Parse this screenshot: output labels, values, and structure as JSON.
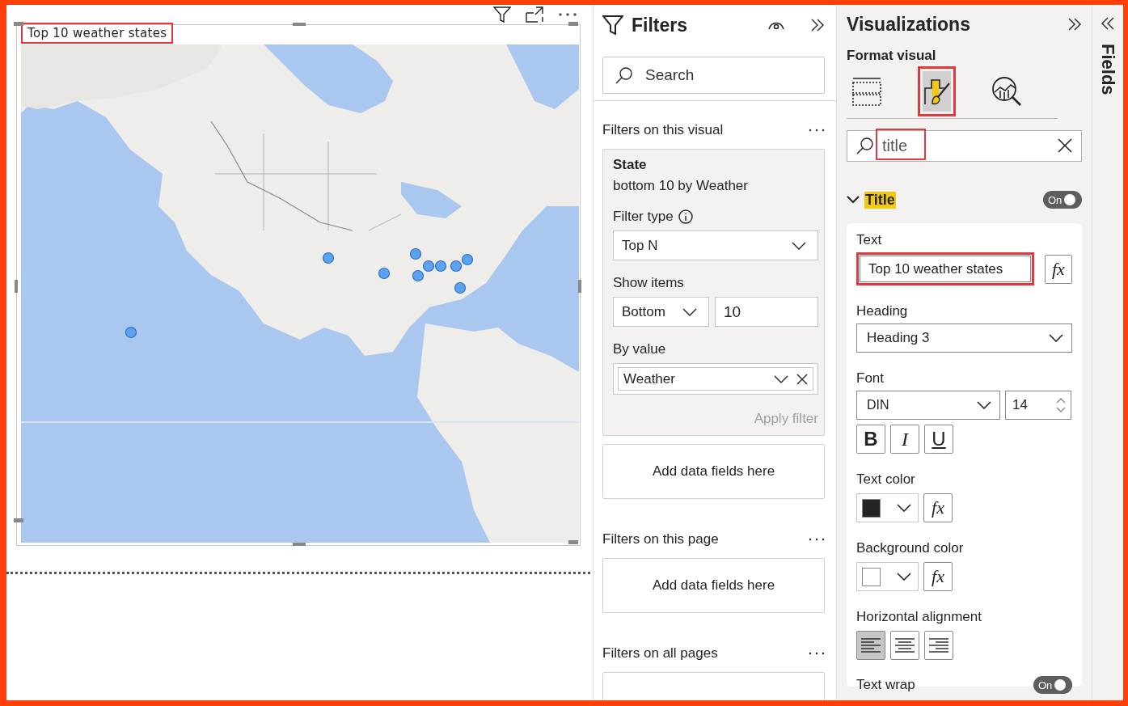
{
  "visual": {
    "title": "Top 10 weather states",
    "title_highlighted": true
  },
  "filters": {
    "title": "Filters",
    "search": {
      "placeholder": "Search"
    },
    "sections": [
      {
        "heading": "Filters on this visual",
        "cards": [
          {
            "kind": "filter",
            "field": "State",
            "summary": "bottom 10 by Weather",
            "filter_type_label": "Filter type",
            "filter_type": "Top N",
            "show_items_label": "Show items",
            "direction": "Bottom",
            "count": "10",
            "by_value_label": "By value",
            "by_value": "Weather",
            "apply": "Apply filter",
            "apply_disabled": true
          },
          {
            "kind": "drop",
            "text": "Add data fields here"
          }
        ]
      },
      {
        "heading": "Filters on this page",
        "cards": [
          {
            "kind": "drop",
            "text": "Add data fields here"
          }
        ]
      },
      {
        "heading": "Filters on all pages",
        "cards": [
          {
            "kind": "drop"
          }
        ]
      }
    ]
  },
  "visualizations": {
    "title": "Visualizations",
    "subtitle": "Format visual",
    "tabs": [
      {
        "kind": "build",
        "selected": false,
        "highlighted": false
      },
      {
        "kind": "format",
        "selected": true,
        "highlighted": true
      },
      {
        "kind": "analytics",
        "selected": false,
        "highlighted": false
      }
    ],
    "search": {
      "value": "title",
      "highlighted": true
    },
    "section": {
      "title": "Title",
      "expanded": true,
      "on": true,
      "toggle_label": "On",
      "text": {
        "label": "Text",
        "value": "Top 10 weather states",
        "highlighted": true,
        "fx": "fx"
      },
      "heading": {
        "label": "Heading",
        "value": "Heading 3"
      },
      "font": {
        "label": "Font",
        "family": "DIN",
        "size": "14"
      },
      "styles": [
        {
          "kind": "bold",
          "label": "B"
        },
        {
          "kind": "italic",
          "label": "I"
        },
        {
          "kind": "underline",
          "label": "U"
        }
      ],
      "text_color": {
        "label": "Text color",
        "color": "#252423",
        "fx": "fx"
      },
      "background_color": {
        "label": "Background color",
        "color": "#ffffff",
        "fx": "fx"
      },
      "alignment": {
        "label": "Horizontal alignment",
        "options": [
          {
            "kind": "left",
            "selected": true
          },
          {
            "kind": "center",
            "selected": false
          },
          {
            "kind": "right",
            "selected": false
          }
        ]
      },
      "text_wrap": {
        "label": "Text wrap",
        "on": true,
        "toggle_label": "On"
      }
    }
  },
  "fields_pane": {
    "title": "Fields"
  }
}
